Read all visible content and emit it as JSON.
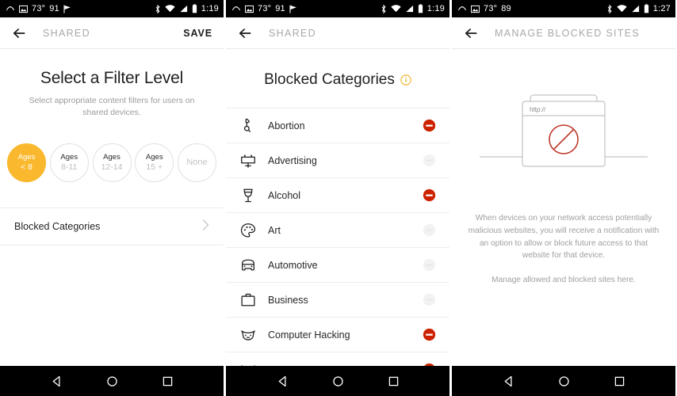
{
  "colors": {
    "accent": "#f9b82e",
    "blocked": "#cc2200",
    "unblocked": "#f0f0f0",
    "statusbar_bg": "#000000",
    "text_primary": "#1f1f1f",
    "text_secondary": "#a0a0a0"
  },
  "panels": [
    {
      "id": "filter-level",
      "statusbar": {
        "temperature": "73°",
        "battery_percent": "91",
        "time": "1:19",
        "left_icons": [
          "hangouts-icon",
          "screenshot-icon",
          "flag-icon"
        ],
        "right_icons": [
          "bluetooth-icon",
          "wifi-icon",
          "signal-icon",
          "battery-icon"
        ]
      },
      "appbar": {
        "back_icon": "back-arrow-icon",
        "title": "SHARED",
        "action_label": "SAVE"
      },
      "heading": "Select a Filter Level",
      "subheading": "Select appropriate content filters for users on shared devices.",
      "age_options": [
        {
          "line1": "Ages",
          "line2": "< 8",
          "selected": true
        },
        {
          "line1": "Ages",
          "line2": "8-11",
          "selected": false
        },
        {
          "line1": "Ages",
          "line2": "12-14",
          "selected": false
        },
        {
          "line1": "Ages",
          "line2": "15 +",
          "selected": false
        },
        {
          "line1": "None",
          "line2": "",
          "selected": false
        }
      ],
      "link_row": {
        "label": "Blocked Categories",
        "chevron": "chevron-right-icon"
      }
    },
    {
      "id": "blocked-categories",
      "statusbar": {
        "temperature": "73°",
        "battery_percent": "91",
        "time": "1:19",
        "left_icons": [
          "hangouts-icon",
          "screenshot-icon",
          "flag-icon"
        ],
        "right_icons": [
          "bluetooth-icon",
          "wifi-icon",
          "signal-icon",
          "battery-icon"
        ]
      },
      "appbar": {
        "back_icon": "back-arrow-icon",
        "title": "SHARED",
        "action_label": ""
      },
      "heading": "Blocked Categories",
      "info_icon": "info-icon",
      "categories": [
        {
          "name": "Abortion",
          "icon": "abortion-icon",
          "blocked": true
        },
        {
          "name": "Advertising",
          "icon": "billboard-icon",
          "blocked": false
        },
        {
          "name": "Alcohol",
          "icon": "wine-glass-icon",
          "blocked": true
        },
        {
          "name": "Art",
          "icon": "palette-icon",
          "blocked": false
        },
        {
          "name": "Automotive",
          "icon": "car-icon",
          "blocked": false
        },
        {
          "name": "Business",
          "icon": "briefcase-icon",
          "blocked": false
        },
        {
          "name": "Computer Hacking",
          "icon": "mask-icon",
          "blocked": true
        },
        {
          "name": "",
          "icon": "partial-icon",
          "blocked": true
        }
      ]
    },
    {
      "id": "manage-blocked-sites",
      "statusbar": {
        "temperature": "73°",
        "battery_percent": "89",
        "time": "1:27",
        "left_icons": [
          "hangouts-icon",
          "screenshot-icon"
        ],
        "right_icons": [
          "bluetooth-icon",
          "wifi-icon",
          "signal-icon",
          "battery-icon"
        ]
      },
      "appbar": {
        "back_icon": "back-arrow-icon",
        "title": "MANAGE BLOCKED SITES",
        "action_label": ""
      },
      "illustration": {
        "name": "blocked-website-illustration",
        "url_label": "http://",
        "symbol": "no-entry-icon"
      },
      "paragraph": "When devices on your network access potentially malicious websites, you will receive a notification with an option to allow or block future access to that website for that device.",
      "paragraph2": "Manage allowed and blocked sites here."
    }
  ],
  "navbar": {
    "back": "nav-back-icon",
    "home": "nav-home-icon",
    "recents": "nav-recents-icon"
  }
}
